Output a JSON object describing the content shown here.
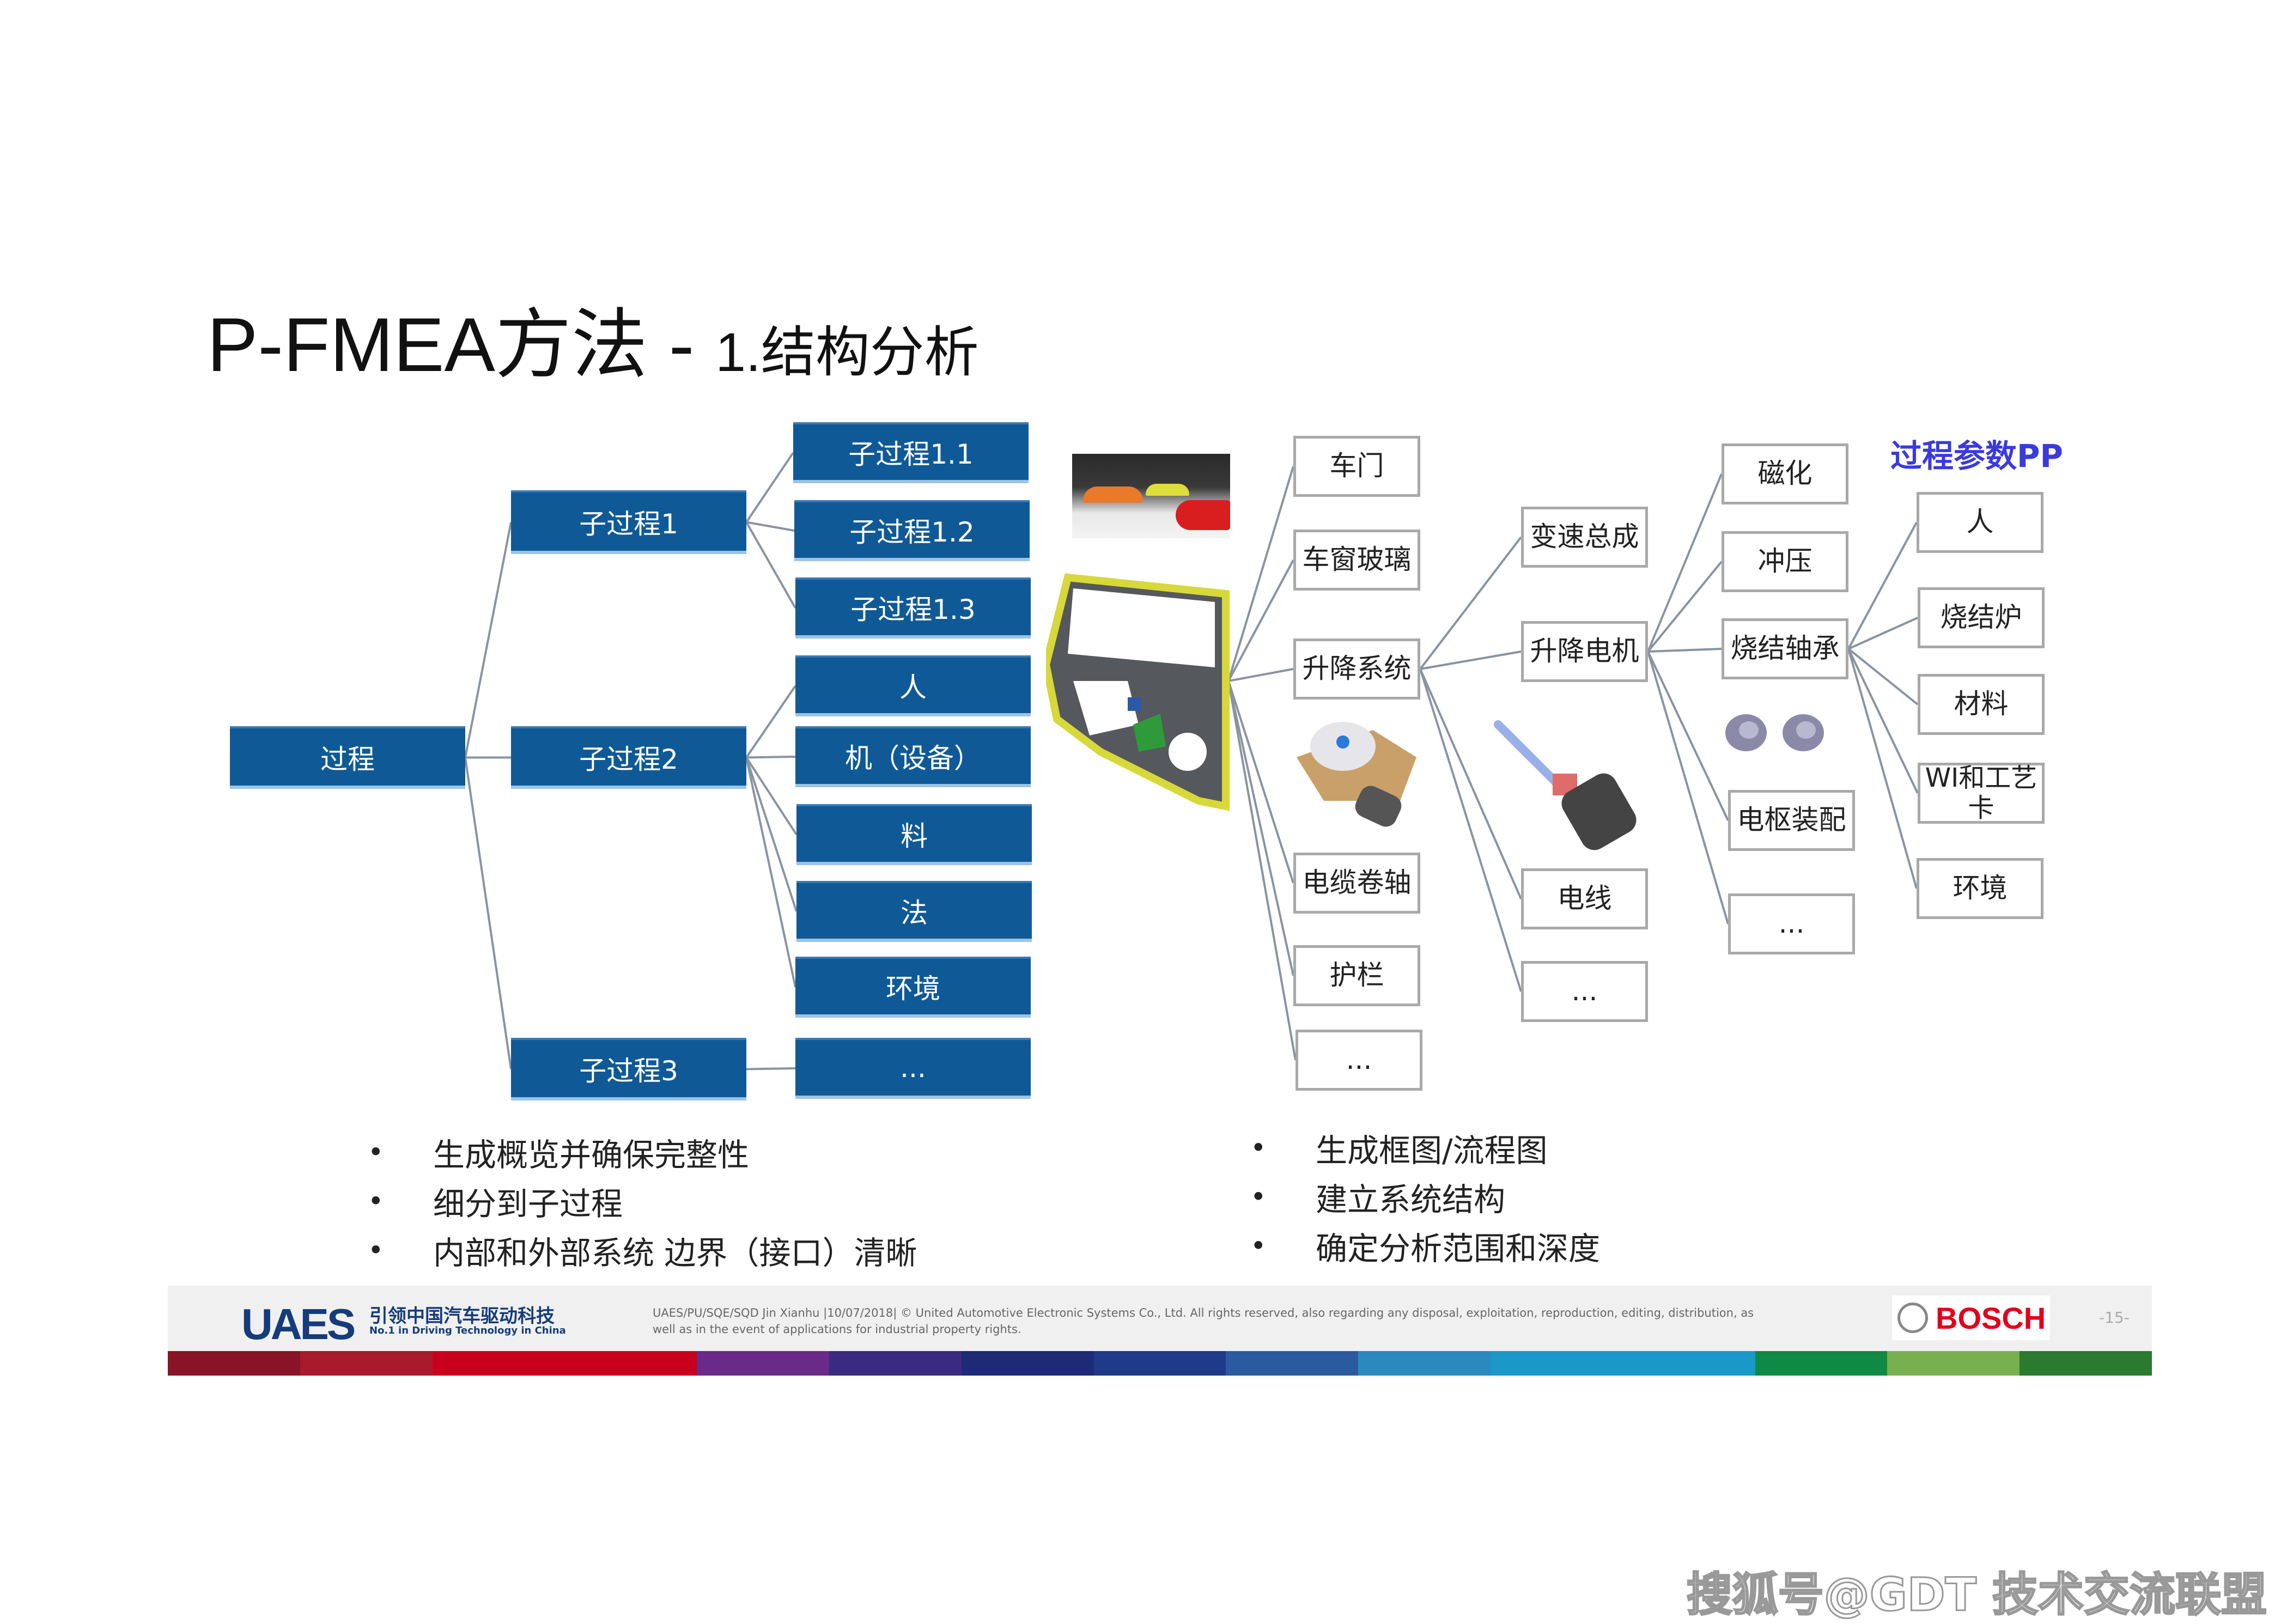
{
  "title": {
    "main": "P-FMEA方法 - ",
    "sub": "1.结构分析"
  },
  "process_tree": {
    "root": "过程",
    "level1": [
      "子过程1",
      "子过程2",
      "子过程3"
    ],
    "level2": {
      "sub1": [
        "子过程1.1",
        "子过程1.2",
        "子过程1.3"
      ],
      "sub2": [
        "人",
        "机（设备）",
        "料",
        "法",
        "环境"
      ],
      "sub3": [
        "..."
      ]
    }
  },
  "structure_tree": {
    "level1": [
      "车门",
      "车窗玻璃",
      "升降系统",
      "电缆卷轴",
      "护栏",
      "..."
    ],
    "level2": [
      "变速总成",
      "升降电机",
      "电线",
      "..."
    ],
    "level3": [
      "磁化",
      "冲压",
      "烧结轴承",
      "电枢装配",
      "..."
    ],
    "pp_title": "过程参数PP",
    "level4": [
      "人",
      "烧结炉",
      "材料",
      "WI和工艺卡",
      "环境"
    ]
  },
  "images": [
    "car-photo",
    "door-assembly",
    "window-regulator",
    "motor",
    "bearings"
  ],
  "bullets_left": [
    "生成概览并确保完整性",
    "细分到子过程",
    "内部和外部系统 边界（接口）清晰"
  ],
  "bullets_right": [
    "生成框图/流程图",
    "建立系统结构",
    "确定分析范围和深度"
  ],
  "bullet_glyph": "•",
  "footer": {
    "logo_text": "UAES",
    "logo_cn": "引领中国汽车驱动科技",
    "logo_en": "No.1 in Driving Technology in China",
    "copyright_line1": "UAES/PU/SQE/SQD Jin Xianhu |10/07/2018| © United Automotive Electronic Systems Co., Ltd. All rights reserved, also regarding any disposal, exploitation, reproduction, editing, distribution, as",
    "copyright_line2": "well as in the event of applications for industrial property rights.",
    "bosch": "BOSCH",
    "page": "-15-"
  },
  "stripe_colors": [
    "#8a1427",
    "#a81a2c",
    "#c8001e",
    "#c8001e",
    "#6a2a8a",
    "#3a2a80",
    "#1e2a78",
    "#1e3a88",
    "#2a5aa0",
    "#2a8ac0",
    "#1a98c8",
    "#1a98c8",
    "#0e8a44",
    "#78b050",
    "#2a7a30"
  ],
  "colors": {
    "node_blue": "#0f5a96",
    "pp_title": "#3a3adf",
    "bosch_red": "#e2001a",
    "uaes_blue": "#143c7a"
  },
  "watermark": "搜狐号@GDT 技术交流联盟"
}
